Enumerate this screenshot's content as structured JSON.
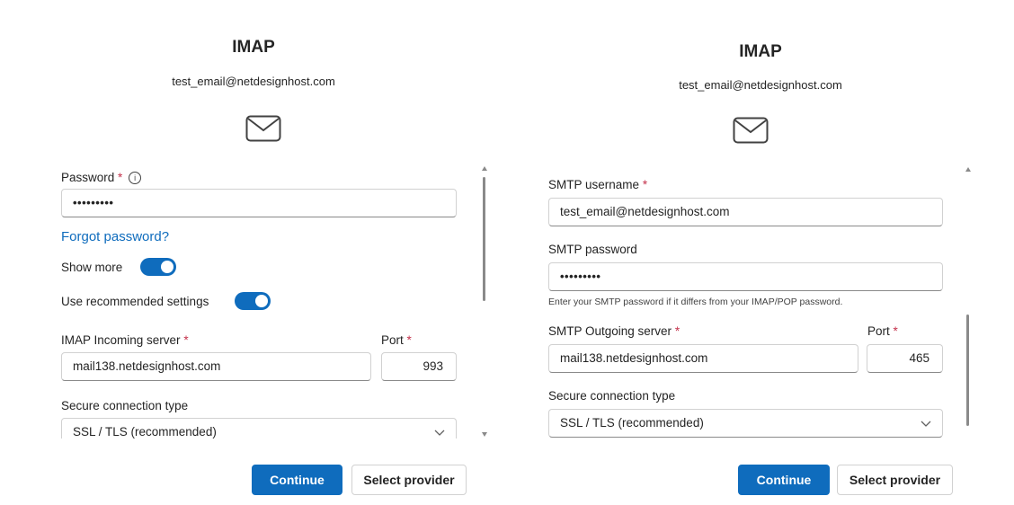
{
  "left": {
    "title": "IMAP",
    "email": "test_email@netdesignhost.com",
    "icon": "mail-icon",
    "password_label": "Password",
    "password_required": "*",
    "password_value": "•••••••••",
    "info_icon": "ⓘ",
    "forgot_password": "Forgot password?",
    "show_more_label": "Show more",
    "show_more_on": true,
    "recommended_label": "Use recommended settings",
    "recommended_on": true,
    "incoming_server_label": "IMAP Incoming server",
    "incoming_server_required": "*",
    "incoming_server_value": "mail138.netdesignhost.com",
    "port_label": "Port",
    "port_required": "*",
    "port_value": "993",
    "secure_label": "Secure connection type",
    "secure_value": "SSL / TLS (recommended)",
    "continue_label": "Continue",
    "select_provider_label": "Select provider"
  },
  "right": {
    "title": "IMAP",
    "email": "test_email@netdesignhost.com",
    "icon": "mail-icon",
    "smtp_username_label": "SMTP username",
    "smtp_username_required": "*",
    "smtp_username_value": "test_email@netdesignhost.com",
    "smtp_password_label": "SMTP password",
    "smtp_password_value": "•••••••••",
    "smtp_password_hint": "Enter your SMTP password if it differs from your IMAP/POP password.",
    "outgoing_server_label": "SMTP Outgoing server",
    "outgoing_server_required": "*",
    "outgoing_server_value": "mail138.netdesignhost.com",
    "port_label": "Port",
    "port_required": "*",
    "port_value": "465",
    "secure_label": "Secure connection type",
    "secure_value": "SSL / TLS (recommended)",
    "continue_label": "Continue",
    "select_provider_label": "Select provider"
  },
  "colors": {
    "accent": "#0f6cbd",
    "required": "#c4314b"
  }
}
